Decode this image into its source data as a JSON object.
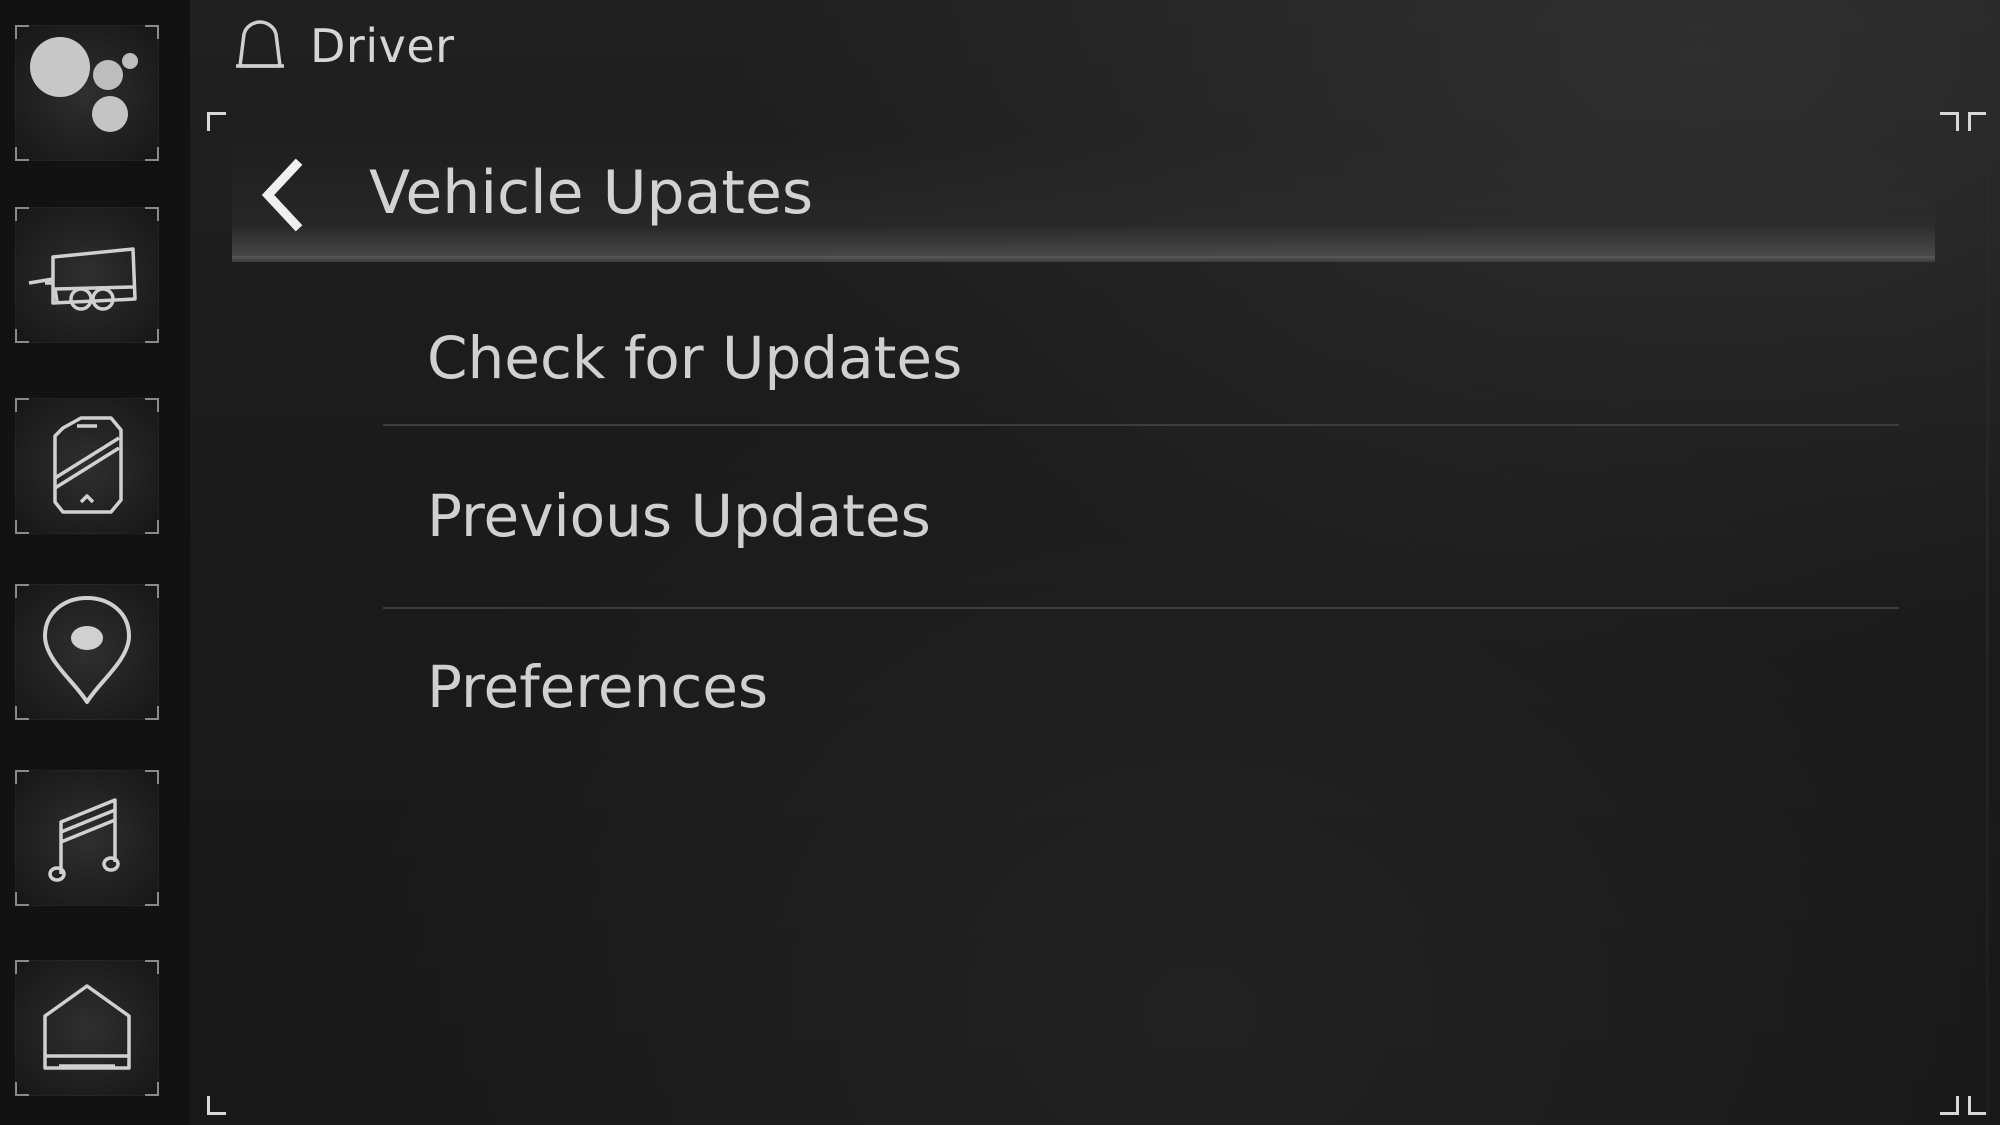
{
  "header": {
    "profile_label": "Driver",
    "profile_icon": "bell-icon"
  },
  "page": {
    "title": "Vehicle Upates",
    "back_icon": "chevron-left-icon"
  },
  "menu": {
    "items": [
      {
        "label": "Check for Updates"
      },
      {
        "label": "Previous Updates"
      },
      {
        "label": "Preferences"
      }
    ]
  },
  "sidebar": {
    "items": [
      {
        "name": "assistant",
        "icon": "assistant-dots-icon"
      },
      {
        "name": "trailer",
        "icon": "trailer-icon"
      },
      {
        "name": "phone",
        "icon": "phone-icon"
      },
      {
        "name": "navigation",
        "icon": "map-pin-icon"
      },
      {
        "name": "audio",
        "icon": "music-note-icon"
      },
      {
        "name": "home",
        "icon": "home-icon"
      }
    ]
  },
  "colors": {
    "background": "#1b1b1b",
    "rail": "#121212",
    "text": "#d0d0d0",
    "divider": "#3d3d3d",
    "corner": "#d8d8d8"
  }
}
